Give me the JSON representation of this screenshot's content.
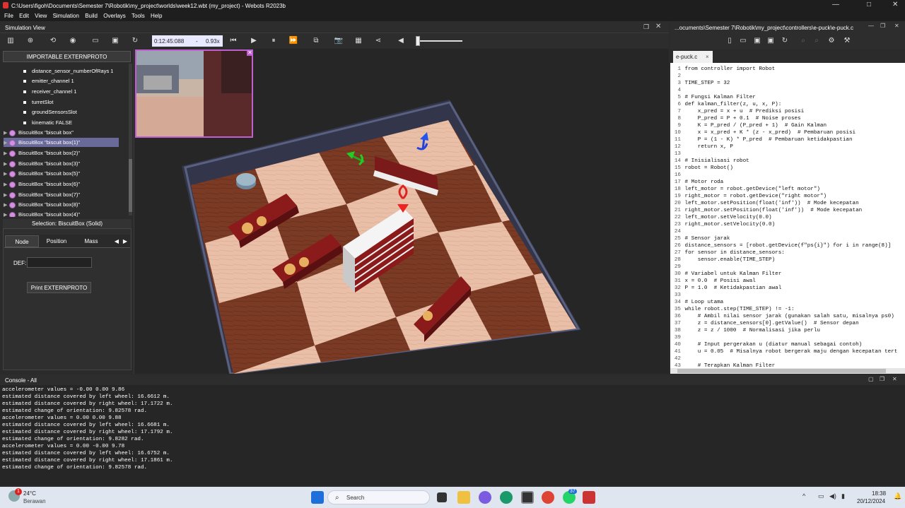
{
  "window": {
    "title": "C:\\Users\\figoh\\Documents\\Semester 7\\Robotik\\my_project\\worlds\\week12.wbt (my_project) - Webots R2023b",
    "minimize": "—",
    "maximize": "□",
    "close": "✕"
  },
  "menu": [
    "File",
    "Edit",
    "View",
    "Simulation",
    "Build",
    "Overlays",
    "Tools",
    "Help"
  ],
  "sim_view": {
    "title": "Simulation View",
    "time": "0:12:45:088",
    "speed_sep": "-",
    "speed": "0.93x"
  },
  "scene_tree": {
    "proto_button": "IMPORTABLE EXTERNPROTO",
    "fields": [
      "distance_sensor_numberOfRays 1",
      "emitter_channel 1",
      "receiver_channel 1",
      "turretSlot",
      "groundSensorsSlot",
      "kinematic FALSE"
    ],
    "nodes": [
      "BiscuitBox \"biscuit box\"",
      "BiscuitBox \"biscuit box(1)\"",
      "BiscuitBox \"biscuit box(2)\"",
      "BiscuitBox \"biscuit box(3)\"",
      "BiscuitBox \"biscuit box(5)\"",
      "BiscuitBox \"biscuit box(6)\"",
      "BiscuitBox \"biscuit box(7)\"",
      "BiscuitBox \"biscuit box(8)\"",
      "BiscuitBox \"biscuit box(4)\""
    ],
    "selected_index": 1
  },
  "selection": {
    "title": "Selection: BiscuitBox (Solid)",
    "tabs": [
      "Node",
      "Position",
      "Mass"
    ],
    "active_tab": "Node",
    "def_label": "DEF:",
    "def_value": "",
    "print_button": "Print EXTERNPROTO"
  },
  "editor": {
    "path": "...ocuments\\Semester 7\\Robotik\\my_project\\controllers\\e-puck\\e-puck.c",
    "tab": "e-puck.c",
    "lines": [
      {
        "n": "1",
        "t": "from controller import Robot"
      },
      {
        "n": "2",
        "t": ""
      },
      {
        "n": "3",
        "t": "TIME_STEP = 32"
      },
      {
        "n": "4",
        "t": ""
      },
      {
        "n": "5",
        "t": "# Fungsi Kalman Filter"
      },
      {
        "n": "6",
        "t": "def kalman_filter(z, u, x, P):"
      },
      {
        "n": "7",
        "t": "    x_pred = x + u  # Prediksi posisi"
      },
      {
        "n": "8",
        "t": "    P_pred = P + 0.1  # Noise proses"
      },
      {
        "n": "9",
        "t": "    K = P_pred / (P_pred + 1)  # Gain Kalman"
      },
      {
        "n": "10",
        "t": "    x = x_pred + K * (z - x_pred)  # Pembaruan posisi"
      },
      {
        "n": "11",
        "t": "    P = (1 - K) * P_pred  # Pembaruan ketidakpastian"
      },
      {
        "n": "12",
        "t": "    return x, P"
      },
      {
        "n": "13",
        "t": ""
      },
      {
        "n": "14",
        "t": "# Inisialisasi robot"
      },
      {
        "n": "15",
        "t": "robot = Robot()"
      },
      {
        "n": "16",
        "t": ""
      },
      {
        "n": "17",
        "t": "# Motor roda"
      },
      {
        "n": "18",
        "t": "left_motor = robot.getDevice(\"left motor\")"
      },
      {
        "n": "19",
        "t": "right_motor = robot.getDevice(\"right motor\")"
      },
      {
        "n": "20",
        "t": "left_motor.setPosition(float('inf'))  # Mode kecepatan"
      },
      {
        "n": "21",
        "t": "right_motor.setPosition(float('inf'))  # Mode kecepatan"
      },
      {
        "n": "22",
        "t": "left_motor.setVelocity(0.0)"
      },
      {
        "n": "23",
        "t": "right_motor.setVelocity(0.0)"
      },
      {
        "n": "24",
        "t": ""
      },
      {
        "n": "25",
        "t": "# Sensor jarak"
      },
      {
        "n": "26",
        "t": "distance_sensors = [robot.getDevice(f\"ps{i}\") for i in range(8)]"
      },
      {
        "n": "27",
        "t": "for sensor in distance_sensors:"
      },
      {
        "n": "28",
        "t": "    sensor.enable(TIME_STEP)"
      },
      {
        "n": "29",
        "t": ""
      },
      {
        "n": "30",
        "t": "# Variabel untuk Kalman Filter"
      },
      {
        "n": "31",
        "t": "x = 0.0  # Posisi awal"
      },
      {
        "n": "32",
        "t": "P = 1.0  # Ketidakpastian awal"
      },
      {
        "n": "33",
        "t": ""
      },
      {
        "n": "34",
        "t": "# Loop utama"
      },
      {
        "n": "35",
        "t": "while robot.step(TIME_STEP) != -1:"
      },
      {
        "n": "36",
        "t": "    # Ambil nilai sensor jarak (gunakan salah satu, misalnya ps0)"
      },
      {
        "n": "37",
        "t": "    z = distance_sensors[0].getValue()  # Sensor depan"
      },
      {
        "n": "38",
        "t": "    z = z / 1000  # Normalisasi jika perlu"
      },
      {
        "n": "39",
        "t": ""
      },
      {
        "n": "40",
        "t": "    # Input pergerakan u (diatur manual sebagai contoh)"
      },
      {
        "n": "41",
        "t": "    u = 0.05  # Misalnya robot bergerak maju dengan kecepatan tert"
      },
      {
        "n": "42",
        "t": ""
      },
      {
        "n": "43",
        "t": "    # Terapkan Kalman Filter"
      }
    ]
  },
  "console": {
    "title": "Console - All",
    "lines": [
      "accelerometer values = -0.00 0.00 9.86",
      "estimated distance covered by left wheel: 16.6612 m.",
      "estimated distance covered by right wheel: 17.1722 m.",
      "estimated change of orientation: 9.82578 rad.",
      "accelerometer values = 0.00 0.00 9.88",
      "estimated distance covered by left wheel: 16.6681 m.",
      "estimated distance covered by right wheel: 17.1792 m.",
      "estimated change of orientation: 9.8282 rad.",
      "accelerometer values = 0.00 -0.00 9.78",
      "estimated distance covered by left wheel: 16.6752 m.",
      "estimated distance covered by right wheel: 17.1861 m.",
      "estimated change of orientation: 9.82578 rad."
    ]
  },
  "taskbar": {
    "weather_temp": "24°C",
    "weather_desc": "Berawan",
    "weather_badge": "1",
    "search": "Search",
    "whatsapp_badge": "37",
    "time": "18:38",
    "date": "20/12/2024"
  }
}
